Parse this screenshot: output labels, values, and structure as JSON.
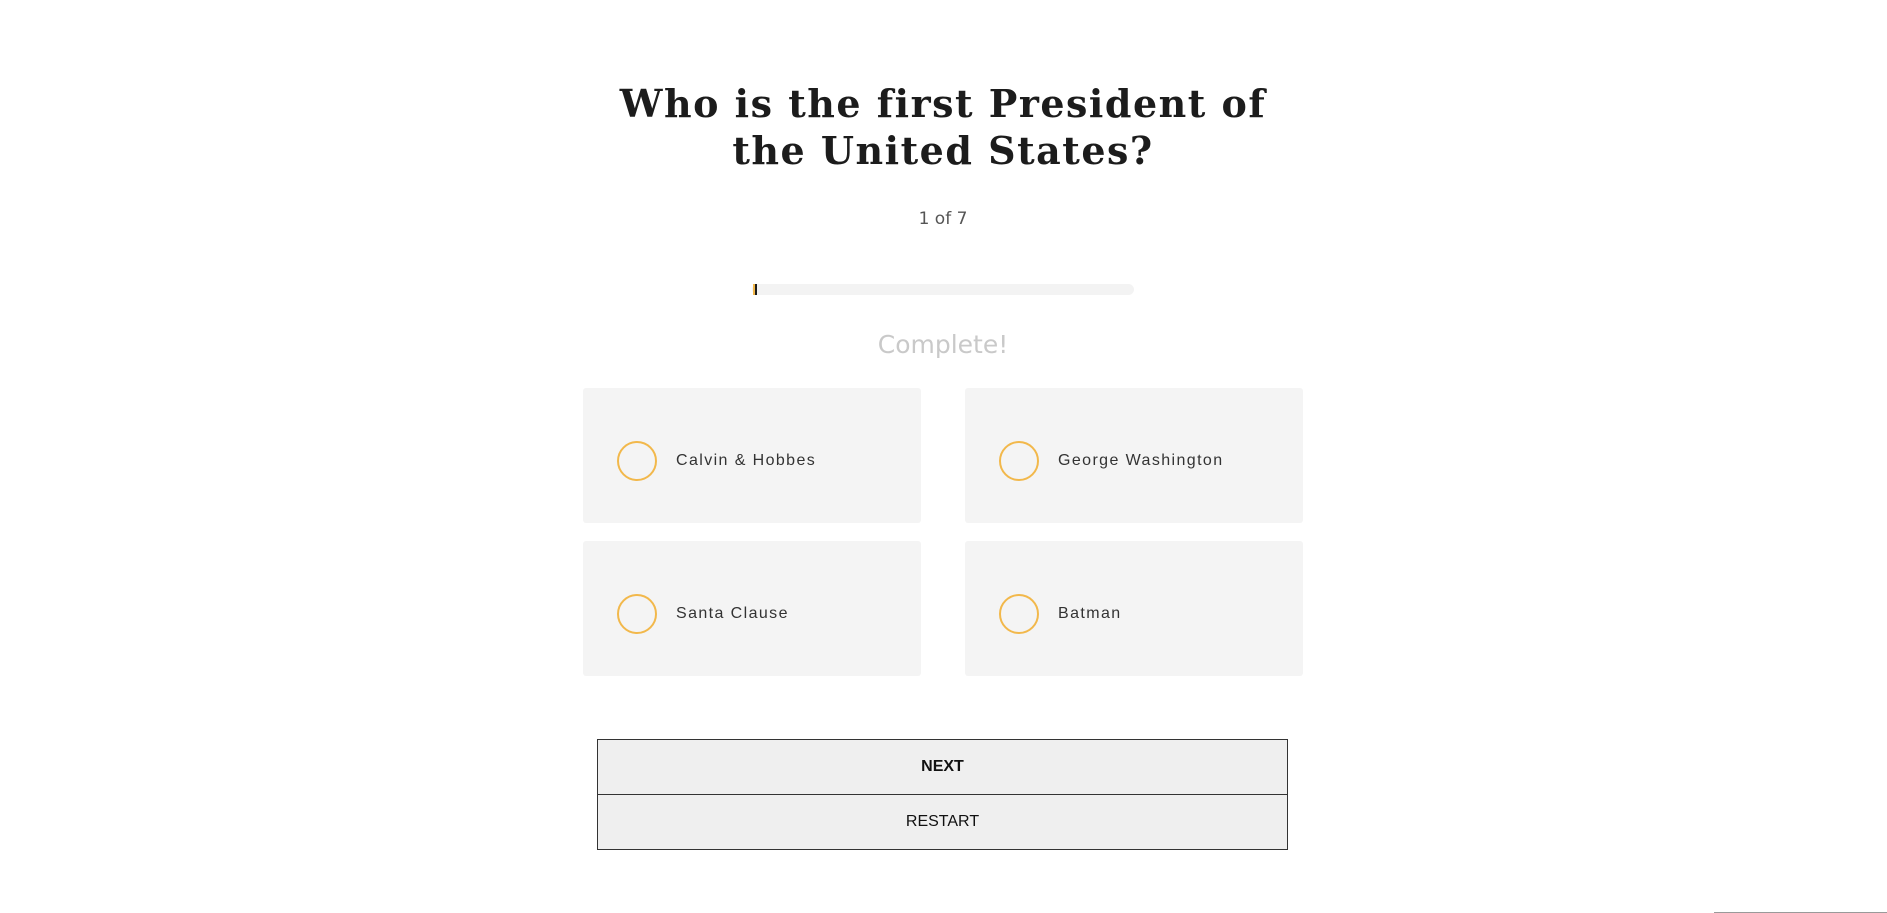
{
  "quiz": {
    "question": "Who is the first President of the United States?",
    "counter": "1 of 7",
    "progress": {
      "current": 1,
      "total": 7,
      "fill_fraction": 0.01
    },
    "complete_label": "Complete!",
    "options": [
      {
        "label": "Calvin & Hobbes"
      },
      {
        "label": "George Washington"
      },
      {
        "label": "Santa Clause"
      },
      {
        "label": "Batman"
      }
    ],
    "buttons": {
      "next_label": "NEXT",
      "restart_label": "RESTART"
    }
  },
  "colors": {
    "accent": "#f2b84b",
    "option_background": "#f4f4f4",
    "title_text": "#1c1c1c",
    "complete_text": "#c9c9c9",
    "button_background": "#efefef"
  },
  "icons": {
    "option_radio": "radio-circle-icon"
  }
}
